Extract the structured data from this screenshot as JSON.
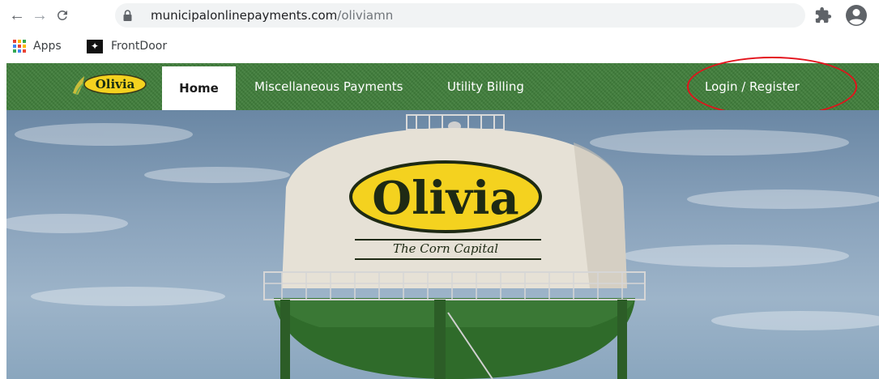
{
  "browser": {
    "url_host": "municipalonlinepayments.com",
    "url_path": "/oliviamn",
    "icons": {
      "back": "arrow-left-icon",
      "forward": "arrow-right-icon",
      "reload": "reload-icon",
      "lock": "lock-icon",
      "star": "star-icon",
      "extensions": "puzzle-icon",
      "profile": "account-circle-icon"
    }
  },
  "bookmarks": [
    {
      "label": "Apps",
      "icon": "apps-grid-icon"
    },
    {
      "label": "FrontDoor",
      "icon": "frontdoor-icon"
    }
  ],
  "site": {
    "logo_text": "Olivia",
    "nav": {
      "home": "Home",
      "misc": "Miscellaneous Payments",
      "utility": "Utility Billing",
      "login": "Login / Register"
    },
    "colors": {
      "nav_green": "#3f7d3a",
      "annotation_red": "#e3121b",
      "logo_yellow": "#f4d21f"
    }
  },
  "hero": {
    "tower_logo": "Olivia",
    "tower_tagline": "The Corn Capital"
  }
}
